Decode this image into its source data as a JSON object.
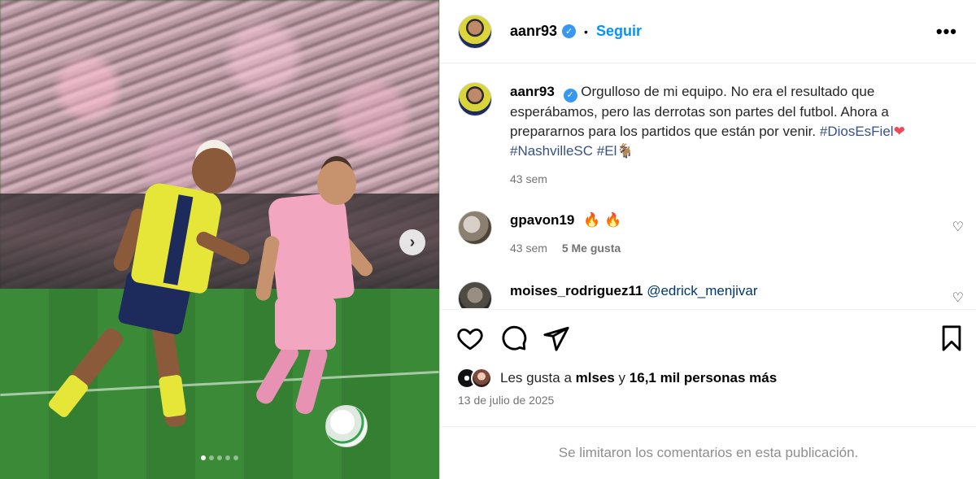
{
  "post": {
    "username": "aanr93",
    "follow_label": "Seguir",
    "more_label": "•••",
    "caption_text": "Orgulloso de mi equipo. No era el resultado que esperábamos, pero las derrotas son partes del futbol. Ahora a prepararnos para los partidos que están por venir.",
    "hashtag_1": "#DiosEsFiel",
    "hashtag_1_emoji": "❤",
    "hashtag_2": "#NashvilleSC",
    "hashtag_3": "#El",
    "hashtag_3_emoji": "🐐",
    "caption_time": "43 sem"
  },
  "comments": [
    {
      "username": "gpavon19",
      "text": "🔥 🔥",
      "time": "43 sem",
      "likes": "5 Me gusta"
    },
    {
      "username": "moises_rodriguez11",
      "text": "@edrick_menjivar"
    }
  ],
  "likes_summary": {
    "prefix": "Les gusta a ",
    "user": "mlses",
    "mid": " y ",
    "others": "16,1 mil personas más"
  },
  "date": "13 de julio de 2025",
  "comments_limited": "Se limitaron los comentarios en esta publicación.",
  "carousel": {
    "slides": 5,
    "current": 1
  },
  "icons": {
    "verified": "verified-badge-icon",
    "next": "chevron-right-icon",
    "like": "heart-icon",
    "comment": "comment-bubble-icon",
    "share": "paper-plane-icon",
    "save": "bookmark-icon"
  },
  "colors": {
    "link": "#0095f6",
    "hashtag": "#385185",
    "muted": "#737373",
    "heart": "#ed4956"
  }
}
